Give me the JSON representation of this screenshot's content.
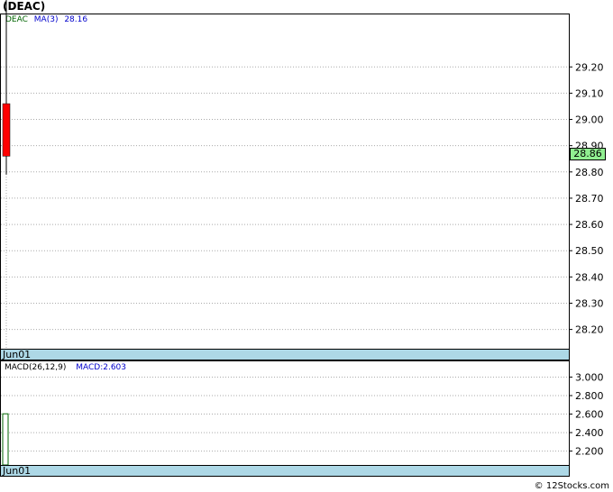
{
  "header": {
    "title": "(DEAC)"
  },
  "price_panel": {
    "legend": {
      "symbol": "DEAC",
      "ma_label": "MA(3)",
      "ma_value": "28.16"
    },
    "last_price_badge": "28.86",
    "date_label": "Jun01",
    "colors": {
      "candle_down": "#ff0000",
      "grid": "#aaaaaa",
      "symbol_text": "#006400",
      "ma_text": "#0000cc",
      "badge": "#90ee90"
    }
  },
  "macd_panel": {
    "legend": {
      "macd_params": "MACD(26,12,9)",
      "macd_value_label": "MACD:2.603"
    },
    "date_label": "Jun01",
    "colors": {
      "bar_border": "#006400",
      "macd_text": "#0000cc"
    }
  },
  "footer": {
    "text": "© 12Stocks.com"
  },
  "chart_data": [
    {
      "type": "candlestick",
      "title": "(DEAC)",
      "x": [
        "Jun01"
      ],
      "candles": [
        {
          "date": "Jun01",
          "open": 29.06,
          "high": 29.49,
          "low": 28.79,
          "close": 28.86
        }
      ],
      "overlays": [
        {
          "name": "MA(3)",
          "value": 28.16
        }
      ],
      "last_value": 28.86,
      "ylim": [
        28.13,
        29.4
      ],
      "yticks": [
        28.2,
        28.3,
        28.4,
        28.5,
        28.6,
        28.7,
        28.8,
        28.9,
        29.0,
        29.1,
        29.2
      ],
      "ytick_labels": [
        "28.20",
        "28.30",
        "28.40",
        "28.50",
        "28.60",
        "28.70",
        "28.80",
        "28.90",
        "29.00",
        "29.10",
        "29.20"
      ],
      "grid": true
    },
    {
      "type": "bar",
      "title": "MACD(26,12,9)",
      "x": [
        "Jun01"
      ],
      "values": [
        2.603
      ],
      "ylim": [
        2.05,
        3.17
      ],
      "yticks": [
        2.2,
        2.4,
        2.6,
        2.8,
        3.0
      ],
      "ytick_labels": [
        "2.200",
        "2.400",
        "2.600",
        "2.800",
        "3.000"
      ],
      "grid": true
    }
  ]
}
